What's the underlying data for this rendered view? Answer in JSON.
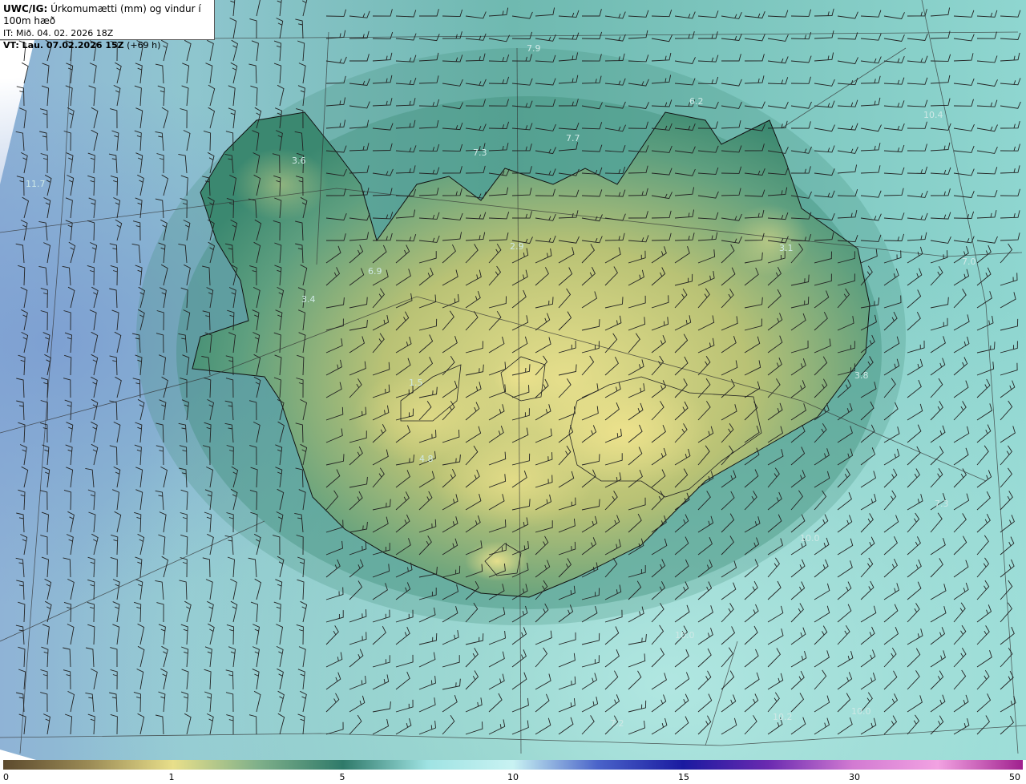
{
  "header": {
    "model": "UWC/IG:",
    "field": "Úrkomumætti (mm) og vindur í 100m hæð",
    "init_time": "IT: Mið. 04. 02. 2026 18Z",
    "valid_time": "VT: Lau. 07.02.2026 15Z",
    "lead": "(+69 h)"
  },
  "legend": {
    "ticks": [
      "0",
      "1",
      "5",
      "10",
      "15",
      "30",
      "50"
    ],
    "colors": [
      "#5c4a2e",
      "#9a8a55",
      "#e8df8a",
      "#7fb08a",
      "#2f7a6a",
      "#9fe3e3",
      "#c8f2f2",
      "#4a63c9",
      "#1a1aa0",
      "#6a2ab0",
      "#d27ad2",
      "#f2a2e2",
      "#a0208e"
    ]
  },
  "point_values": [
    {
      "text": "7.9"
    },
    {
      "text": "7.3"
    },
    {
      "text": "7.7"
    },
    {
      "text": "3.6"
    },
    {
      "text": "11.7"
    },
    {
      "text": "2.9"
    },
    {
      "text": "3.1"
    },
    {
      "text": "7.0"
    },
    {
      "text": "6.9"
    },
    {
      "text": "3.4"
    },
    {
      "text": "1.5"
    },
    {
      "text": "4.8"
    },
    {
      "text": "3.8"
    },
    {
      "text": "7.3"
    },
    {
      "text": "10.0"
    },
    {
      "text": "10.0"
    },
    {
      "text": "10.2"
    },
    {
      "text": "7.2"
    },
    {
      "text": "10.0"
    },
    {
      "text": "10.4"
    },
    {
      "text": "6.2"
    }
  ],
  "colors": {
    "ocean_blue": "#7aa6cf",
    "ocean_teal": "#7cc6c0",
    "ocean_light": "#a6e0dc",
    "land_green": "#3f8f78",
    "land_yellow": "#e2dc8a",
    "coast": "#111111",
    "barb": "#2a2a2a"
  }
}
